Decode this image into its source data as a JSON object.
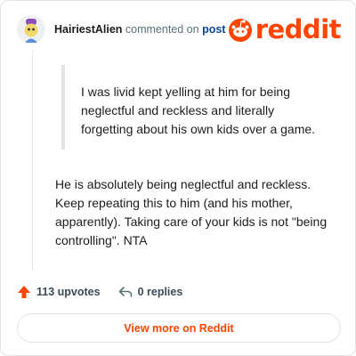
{
  "header": {
    "username": "HairiestAlien",
    "action_text": "commented on",
    "post_link": "post",
    "logo_text": "reddit"
  },
  "comment": {
    "quote": "I was livid kept yelling at him for being neglectful and reckless and literally forgetting about his own kids over a game.",
    "body": "He is absolutely being neglectful and reckless. Keep repeating this to him (and his mother, apparently). Taking care of your kids is not \"being controlling\". NTA"
  },
  "actions": {
    "upvotes": "113 upvotes",
    "replies": "0 replies"
  },
  "cta": {
    "label": "View more on Reddit"
  },
  "colors": {
    "brand": "#ff4500",
    "link": "#0a449b",
    "muted": "#576f76"
  },
  "icons": [
    "avatar-icon",
    "reddit-snoo-icon",
    "upvote-arrow-icon",
    "reply-icon"
  ]
}
